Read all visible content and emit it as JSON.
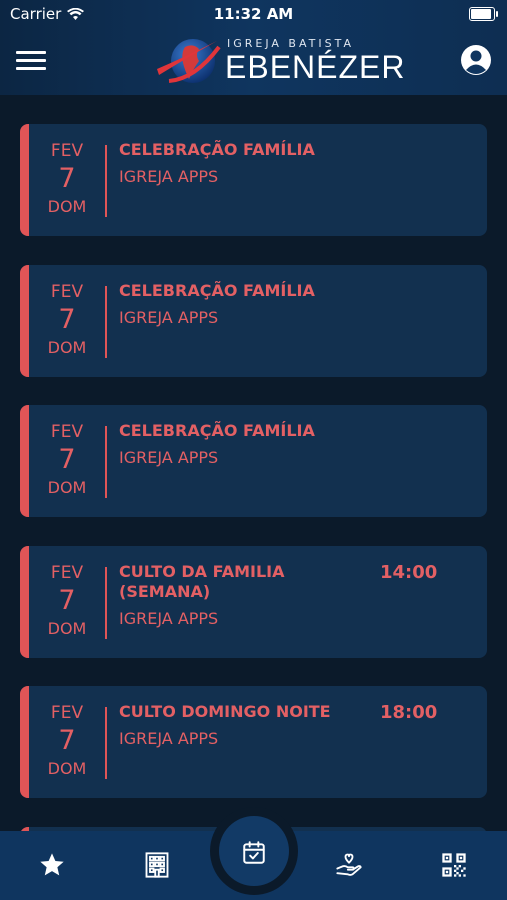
{
  "status_bar": {
    "carrier": "Carrier",
    "time": "11:32 AM"
  },
  "header": {
    "logo_small": "IGREJA BATISTA",
    "logo_big": "EBENÉZER"
  },
  "events": [
    {
      "month": "FEV",
      "day": "7",
      "weekday": "DOM",
      "title": "CELEBRAÇÃO FAMÍLIA",
      "subtitle": "IGREJA APPS",
      "time": ""
    },
    {
      "month": "FEV",
      "day": "7",
      "weekday": "DOM",
      "title": "CELEBRAÇÃO FAMÍLIA",
      "subtitle": "IGREJA APPS",
      "time": ""
    },
    {
      "month": "FEV",
      "day": "7",
      "weekday": "DOM",
      "title": "CELEBRAÇÃO FAMÍLIA",
      "subtitle": "IGREJA APPS",
      "time": ""
    },
    {
      "month": "FEV",
      "day": "7",
      "weekday": "DOM",
      "title": "CULTO DA FAMILIA (SEMANA)",
      "subtitle": "IGREJA APPS",
      "time": "14:00"
    },
    {
      "month": "FEV",
      "day": "7",
      "weekday": "DOM",
      "title": "CULTO DOMINGO NOITE",
      "subtitle": "IGREJA APPS",
      "time": "18:00"
    }
  ],
  "tab_bar": {
    "icons": [
      "star-icon",
      "building-icon",
      "calendar-check-icon",
      "hand-heart-icon",
      "qr-code-icon"
    ],
    "active": "calendar-check-icon"
  },
  "colors": {
    "accent": "#e05557",
    "header": "#0f355f",
    "card": "#12304f",
    "background": "#0b1a2a"
  }
}
